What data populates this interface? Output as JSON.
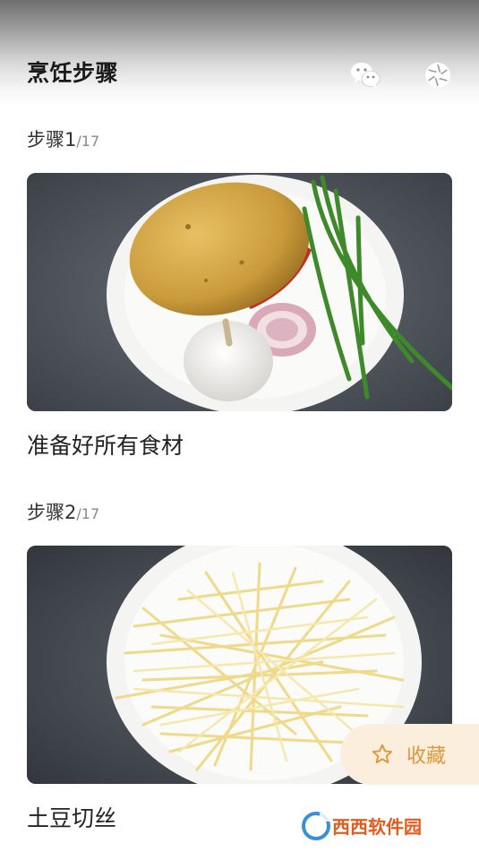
{
  "header": {
    "title": "烹饪步骤",
    "icons": [
      "wechat-icon",
      "moments-icon"
    ]
  },
  "steps": [
    {
      "label": "步骤1",
      "total": "/17",
      "description": "准备好所有食材"
    },
    {
      "label": "步骤2",
      "total": "/17",
      "description": "土豆切丝"
    }
  ],
  "favorite": {
    "label": "收藏",
    "icon": "star-icon"
  },
  "watermark": {
    "brand": "西西软件园"
  },
  "colors": {
    "accent": "#e0973a",
    "accent_bg": "#fbeedd",
    "title": "#1a1a1a"
  }
}
